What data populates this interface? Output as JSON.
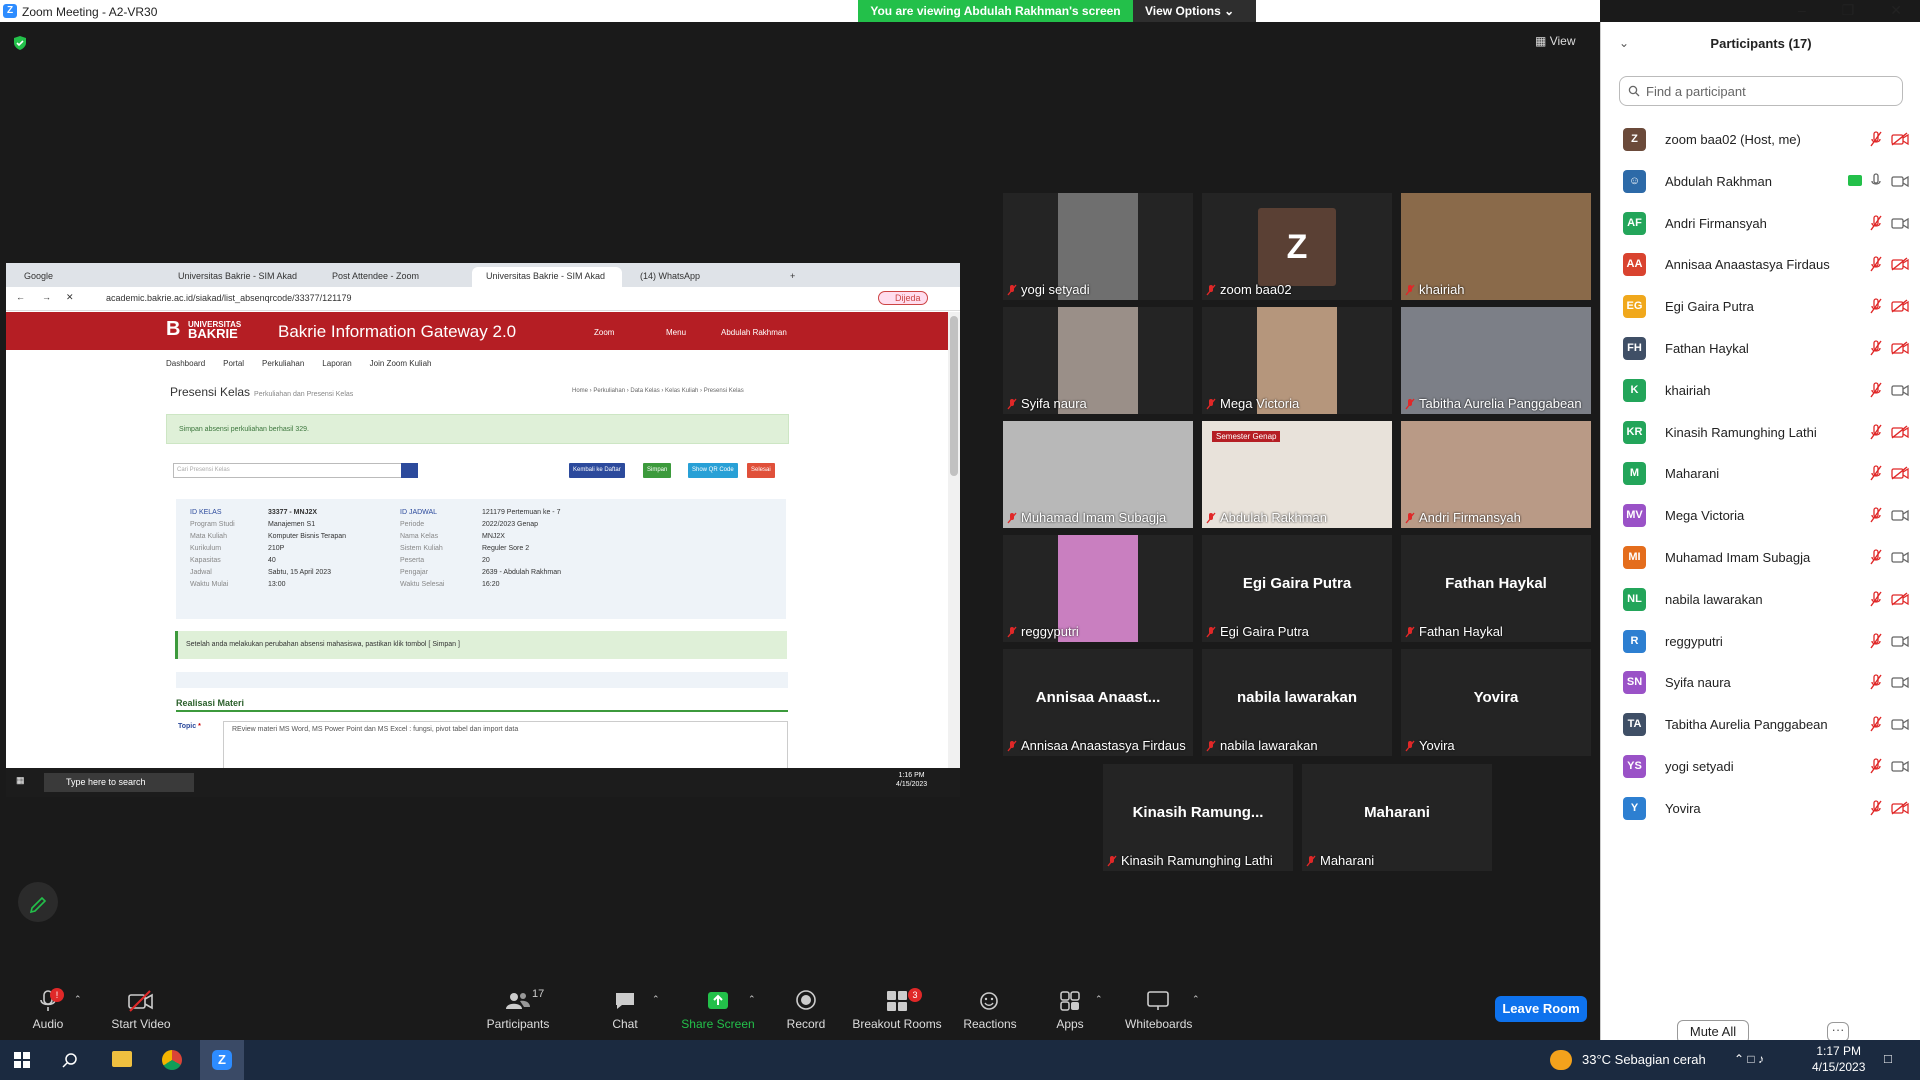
{
  "window": {
    "title": "Zoom Meeting - A2-VR30"
  },
  "banner": {
    "message": "You are viewing Abdulah Rakhman's screen",
    "options": "View Options"
  },
  "view_label": "View",
  "shared": {
    "tabs": [
      "Google",
      "Universitas Bakrie - SIM Akad",
      "Post Attendee - Zoom",
      "Universitas Bakrie - SIM Akad",
      "(14) WhatsApp"
    ],
    "url": "academic.bakrie.ac.id/siakad/list_absenqrcode/33377/121179",
    "profile": "Dijeda",
    "brand_top": "UNIVERSITAS",
    "brand_bottom": "BAKRIE",
    "gateway": "Bakrie Information Gateway 2.0",
    "nav": [
      "Zoom",
      "Menu",
      "Abdulah Rakhman"
    ],
    "submenu": [
      "Dashboard",
      "Portal",
      "Perkuliahan",
      "Laporan",
      "Join Zoom Kuliah"
    ],
    "page_title": "Presensi Kelas",
    "page_sub": "Perkuliahan dan Presensi Kelas",
    "crumbs": "Home › Perkuliahan › Data Kelas › Kelas Kuliah › Presensi Kelas",
    "alert": "Simpan absensi perkuliahan berhasil 329.",
    "search_placeholder": "Cari Presensi Kelas",
    "buttons": [
      "Kembali ke Daftar",
      "Simpan",
      "Show QR Code",
      "Selesai"
    ],
    "info_left": [
      [
        "ID KELAS",
        "33377 - MNJ2X"
      ],
      [
        "Program Studi",
        "Manajemen S1"
      ],
      [
        "Mata Kuliah",
        "Komputer Bisnis Terapan"
      ],
      [
        "Kurikulum",
        "210P"
      ],
      [
        "Kapasitas",
        "40"
      ],
      [
        "Jadwal",
        "Sabtu, 15 April 2023"
      ],
      [
        "Waktu Mulai",
        "13:00"
      ]
    ],
    "info_right": [
      [
        "ID JADWAL",
        "121179 Pertemuan ke - 7"
      ],
      [
        "Periode",
        "2022/2023 Genap"
      ],
      [
        "Nama Kelas",
        "MNJ2X"
      ],
      [
        "Sistem Kuliah",
        "Reguler Sore 2"
      ],
      [
        "Peserta",
        "20"
      ],
      [
        "Pengajar",
        "2639 - Abdulah Rakhman"
      ],
      [
        "Waktu Selesai",
        "16:20"
      ]
    ],
    "notice": "Setelah anda melakukan perubahan absensi mahasiswa, pastikan klik tombol [ Simpan ]",
    "realisasi": "Realisasi Materi",
    "topic_label": "Topic",
    "topic_text": "REview materi MS Word, MS Power Point dan MS Excel : fungsi, pivot tabel dan import data",
    "task_search": "Type here to search",
    "task_time": "1:16 PM",
    "task_date": "4/15/2023"
  },
  "tiles": [
    {
      "name": "yogi setyadi",
      "big": "",
      "video": "#6f6f6f"
    },
    {
      "name": "zoom baa02",
      "big": "",
      "video": ""
    },
    {
      "name": "khairiah",
      "big": "",
      "video": "#8a6a4a"
    },
    {
      "name": "Syifa naura",
      "big": "",
      "video": "#9a8f88"
    },
    {
      "name": "Mega Victoria",
      "big": "",
      "video": "#b5967c"
    },
    {
      "name": "Tabitha Aurelia Panggabean",
      "big": "",
      "video": "#7c7f87"
    },
    {
      "name": "Muhamad Imam Subagja",
      "big": "",
      "video": "#b8b8b8"
    },
    {
      "name": "Abdulah Rakhman",
      "big": "",
      "video": "#e8e2da"
    },
    {
      "name": "Andri Firmansyah",
      "big": "",
      "video": "#b99a86"
    },
    {
      "name": "reggyputri",
      "big": "",
      "video": "#c97fc0"
    },
    {
      "name": "Egi Gaira Putra",
      "big": "Egi Gaira Putra",
      "video": ""
    },
    {
      "name": "Fathan Haykal",
      "big": "Fathan Haykal",
      "video": ""
    },
    {
      "name": "Annisaa Anaastasya Firdaus",
      "big": "Annisaa Anaast...",
      "video": ""
    },
    {
      "name": "nabila lawarakan",
      "big": "nabila lawarakan",
      "video": ""
    },
    {
      "name": "Yovira",
      "big": "Yovira",
      "video": ""
    },
    {
      "name": "Kinasih Ramunghing Lathi",
      "big": "Kinasih Ramung...",
      "video": ""
    },
    {
      "name": "Maharani",
      "big": "Maharani",
      "video": ""
    }
  ],
  "zoom_avatar_letter": "Z",
  "abdulah_tile_text": "Semester Genap",
  "panel": {
    "title": "Participants (17)",
    "find_placeholder": "Find a participant",
    "participants": [
      {
        "initials": "Z",
        "name": "zoom baa02 (Host, me)",
        "color": "#6b4a3a",
        "cam": false
      },
      {
        "initials": "",
        "name": "Abdulah Rakhman",
        "color": "#2d6aa8",
        "cam": true
      },
      {
        "initials": "AF",
        "name": "Andri Firmansyah",
        "color": "#23a55a",
        "cam": true
      },
      {
        "initials": "AA",
        "name": "Annisaa Anaastasya Firdaus",
        "color": "#d9432f",
        "cam": false
      },
      {
        "initials": "EG",
        "name": "Egi Gaira Putra",
        "color": "#f0a81c",
        "cam": false
      },
      {
        "initials": "FH",
        "name": "Fathan Haykal",
        "color": "#3f4f66",
        "cam": false
      },
      {
        "initials": "K",
        "name": "khairiah",
        "color": "#23a55a",
        "cam": true
      },
      {
        "initials": "KR",
        "name": "Kinasih Ramunghing Lathi",
        "color": "#23a55a",
        "cam": false
      },
      {
        "initials": "M",
        "name": "Maharani",
        "color": "#23a55a",
        "cam": false
      },
      {
        "initials": "MV",
        "name": "Mega Victoria",
        "color": "#9a52c7",
        "cam": true
      },
      {
        "initials": "MI",
        "name": "Muhamad Imam Subagja",
        "color": "#e46d1c",
        "cam": true
      },
      {
        "initials": "NL",
        "name": "nabila lawarakan",
        "color": "#23a55a",
        "cam": false
      },
      {
        "initials": "R",
        "name": "reggyputri",
        "color": "#2d7fd1",
        "cam": true
      },
      {
        "initials": "SN",
        "name": "Syifa naura",
        "color": "#9a52c7",
        "cam": true
      },
      {
        "initials": "TA",
        "name": "Tabitha Aurelia Panggabean",
        "color": "#3f4f66",
        "cam": true
      },
      {
        "initials": "YS",
        "name": "yogi setyadi",
        "color": "#9a52c7",
        "cam": true
      },
      {
        "initials": "Y",
        "name": "Yovira",
        "color": "#2d7fd1",
        "cam": false
      }
    ],
    "mute_all": "Mute All",
    "more": "···"
  },
  "toolbar": {
    "audio": "Audio",
    "start_video": "Start Video",
    "participants": "Participants",
    "participants_count": "17",
    "chat": "Chat",
    "share": "Share Screen",
    "record": "Record",
    "breakout": "Breakout Rooms",
    "breakout_badge": "3",
    "reactions": "Reactions",
    "apps": "Apps",
    "whiteboards": "Whiteboards",
    "leave": "Leave Room",
    "audio_badge": "!"
  },
  "taskbar": {
    "weather": "33°C  Sebagian cerah",
    "time": "1:17 PM",
    "date": "4/15/2023"
  },
  "colors": {
    "zoom_blue": "#0e72ed",
    "share_green": "#23c04a",
    "mute_red": "#e02828",
    "bakrie_red": "#b51e24"
  }
}
